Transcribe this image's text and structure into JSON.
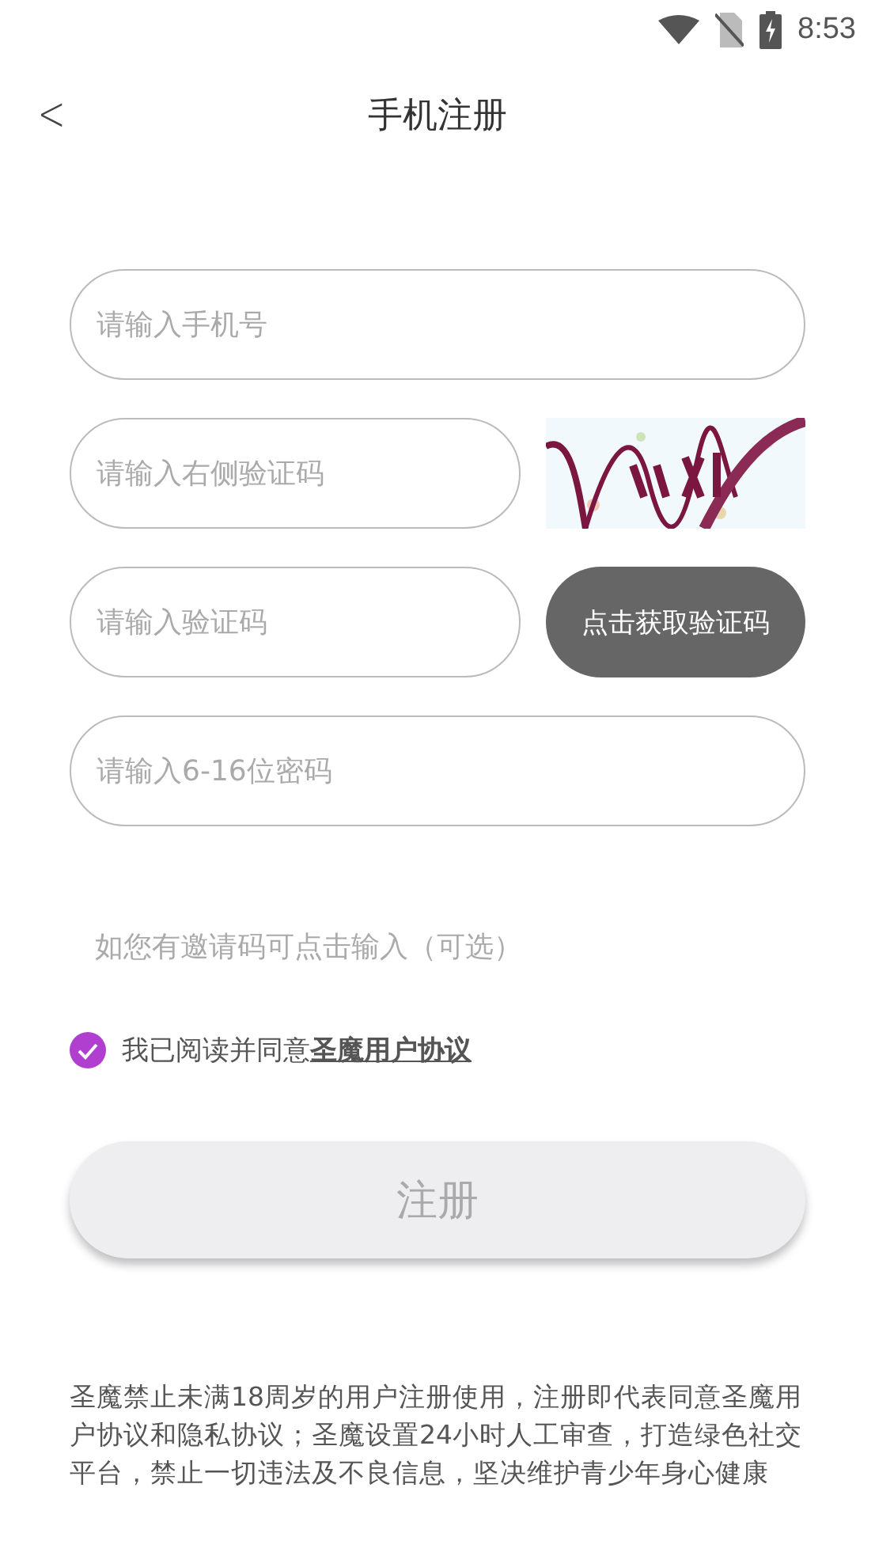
{
  "status_bar": {
    "time": "8:53"
  },
  "header": {
    "back": "<",
    "title": "手机注册"
  },
  "fields": [
    {
      "placeholder": "请输入手机号",
      "kind": "plain"
    },
    {
      "placeholder": "请输入右侧验证码",
      "kind": "captcha"
    },
    {
      "placeholder": "请输入验证码",
      "kind": "sms",
      "button": "点击获取验证码"
    },
    {
      "placeholder": "请输入6-16位密码",
      "kind": "password"
    }
  ],
  "invite": "如您有邀请码可点击输入（可选）",
  "agreement": {
    "checked": true,
    "text": "我已阅读并同意",
    "link": "圣魔用户协议"
  },
  "register_button": {
    "label": "注册",
    "disabled": true
  },
  "notice": "圣魔禁止未满18周岁的用户注册使用，注册即代表同意圣魔用户协议和隐私协议；圣魔设置24小时人工审查，打造绿色社交平台，禁止一切违法及不良信息，坚决维护青少年身心健康"
}
